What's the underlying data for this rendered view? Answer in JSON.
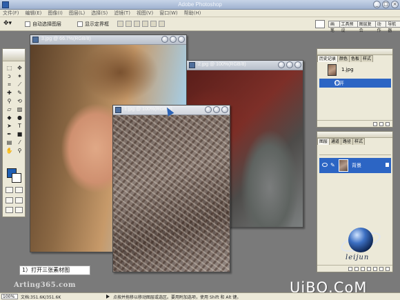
{
  "app": {
    "title": "Adobe Photoshop",
    "window_buttons": [
      "_",
      "□",
      "×"
    ]
  },
  "menu": [
    "文件(F)",
    "编辑(E)",
    "图像(I)",
    "图层(L)",
    "选择(S)",
    "滤镜(T)",
    "视图(V)",
    "窗口(W)",
    "帮助(H)"
  ],
  "options": {
    "auto_select_label": "自动选择图层",
    "show_bounds_label": "显示定界框",
    "well_tabs": [
      "画笔",
      "工具预设",
      "图层复合",
      "动作",
      "导航器"
    ]
  },
  "documents": [
    {
      "title": "3.jpg @ 66.7%(RGB/8)",
      "content": "face"
    },
    {
      "title": "2.jpg @ 100%(RGB/8)",
      "content": "rock"
    },
    {
      "title": "1.jpg @ 100%(RGB/8)",
      "content": "leaves"
    }
  ],
  "history_panel": {
    "tabs": [
      "历史记录",
      "颜色",
      "色板",
      "样式"
    ],
    "snapshot_name": "1.jpg",
    "step": "打开"
  },
  "layers_panel": {
    "tabs": [
      "图层",
      "通道",
      "路径",
      "样式"
    ],
    "layer_name": "背景"
  },
  "colors": {
    "foreground": "#1f5fb3",
    "background": "#ffffff",
    "selection": "#2c65c4"
  },
  "logo": {
    "text": "leijun"
  },
  "caption": "1）打开三张素材图",
  "watermarks": {
    "left": "Arting365.com",
    "right": "UiBQ.CoM"
  },
  "status": {
    "zoom": "100%",
    "doc_size": "文档:351.6K/351.6K",
    "hint": "点按并拖移以移动图层或选区。要用附加选项，使用 Shift 和 Alt 键。"
  }
}
